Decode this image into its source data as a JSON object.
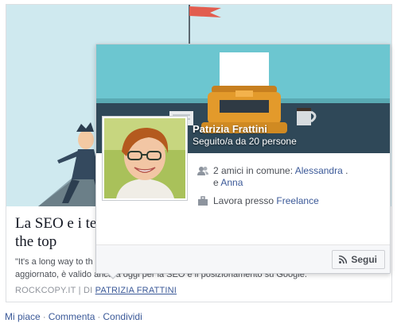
{
  "link_card": {
    "title": "La SEO e i ter",
    "title_line2": "the top",
    "description_line1": "\"It's a long way to th",
    "description_line2": "aggiornato, è valido ancora oggi per la SEO e il posizionamento su Google.",
    "source": "ROCKCOPY.IT",
    "separator": "|",
    "by_label": "DI",
    "author": "PATRIZIA FRATTINI"
  },
  "actions": {
    "like": "Mi piace",
    "comment": "Commenta",
    "share": "Condividi",
    "dot": "·"
  },
  "hovercard": {
    "name": "Patrizia Frattini",
    "followers": "Seguito/a da 20 persone",
    "mutual_prefix": "2 amici in comune: ",
    "mutual_friend_1": "Alessandra",
    "mutual_dot": ".",
    "mutual_and": "e ",
    "mutual_friend_2": "Anna",
    "work_prefix": "Lavora presso ",
    "work_place": "Freelance",
    "follow_label": "Segui"
  },
  "colors": {
    "link_blue": "#3b5998",
    "cover_teal": "#6cc6d0",
    "typewriter_orange": "#e39a2b"
  },
  "icons": [
    "friends-icon",
    "briefcase-icon",
    "rss-icon"
  ]
}
